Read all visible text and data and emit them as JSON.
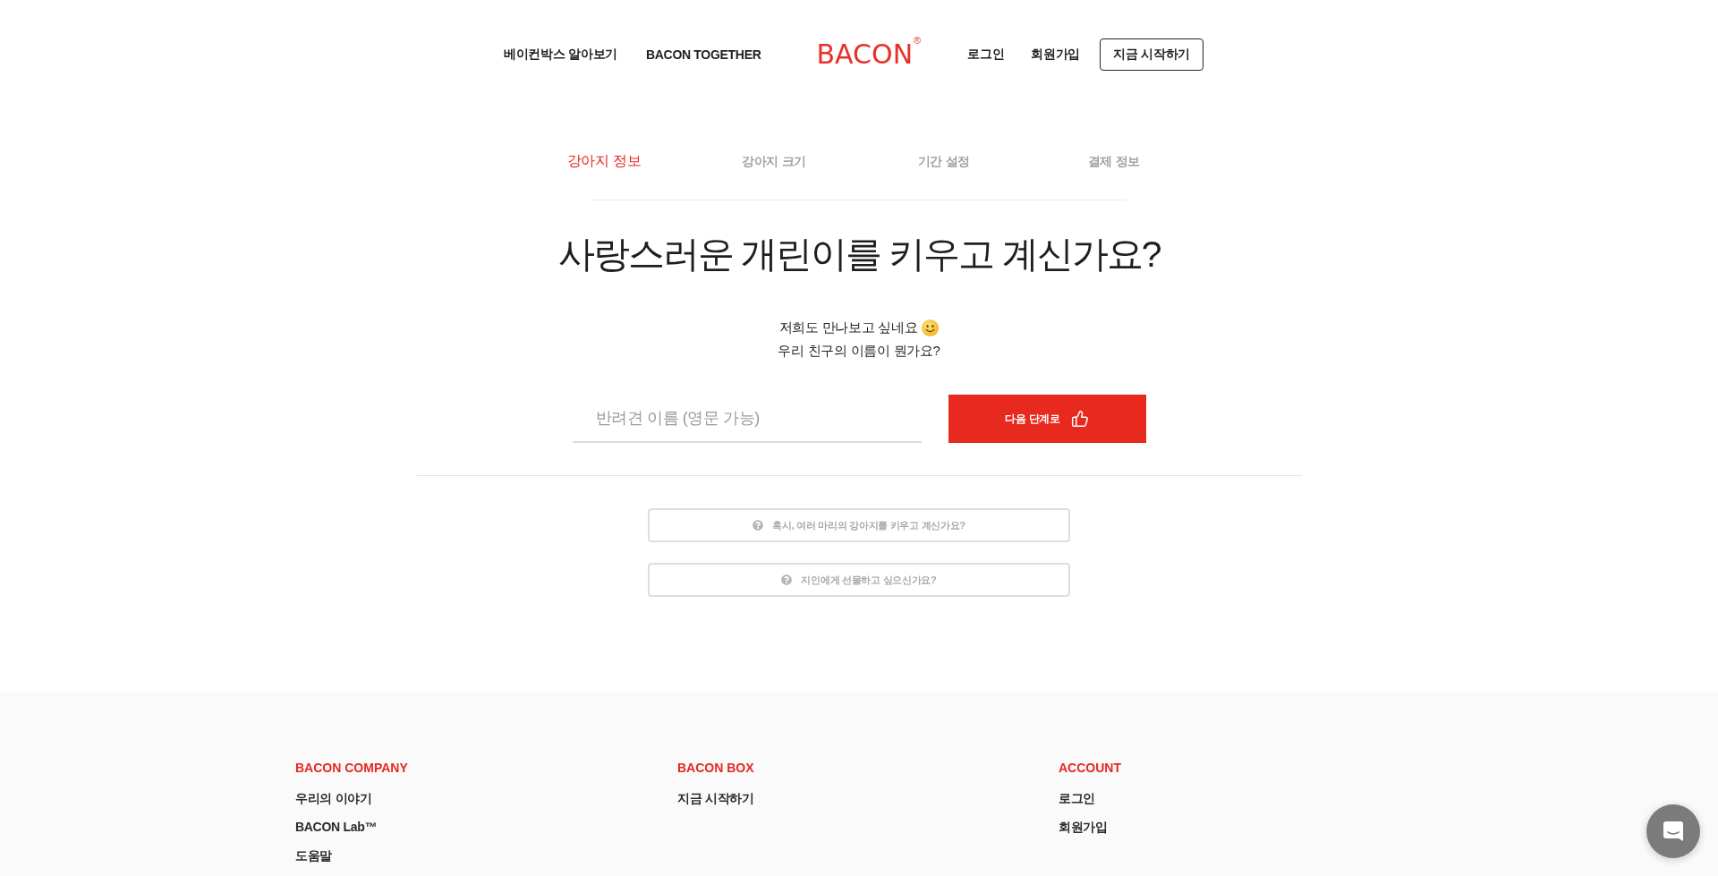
{
  "header": {
    "nav_left": [
      "베이컨박스 알아보기",
      "BACON TOGETHER"
    ],
    "logo": {
      "text": "BACON",
      "mark": "®"
    },
    "nav_right": [
      "로그인",
      "회원가입"
    ],
    "cta": "지금 시작하기"
  },
  "steps": [
    {
      "label": "강아지 정보",
      "selected": true
    },
    {
      "label": "강아지 크기",
      "selected": false
    },
    {
      "label": "기간 설정",
      "selected": false
    },
    {
      "label": "결제 정보",
      "selected": false
    }
  ],
  "question": {
    "title": "사랑스러운 개린이를 키우고 계신가요?",
    "lines": [
      "저희도 만나보고 싶네요",
      "우리 친구의 이름이 뭔가요?"
    ]
  },
  "name_field": {
    "placeholder": "반려견 이름 (영문 가능)"
  },
  "next_button": {
    "label": "다음 단계로"
  },
  "faq": [
    "혹시, 여러 마리의 강아지를 키우고 계신가요?",
    "지인에게 선물하고 싶으신가요?"
  ],
  "footer": {
    "columns": [
      {
        "heading": "BACON COMPANY",
        "links": [
          "우리의 이야기",
          "BACON Lab™",
          "도움말"
        ]
      },
      {
        "heading": "BACON BOX",
        "links": [
          "지금 시작하기"
        ]
      },
      {
        "heading": "ACCOUNT",
        "links": [
          "로그인",
          "회원가입"
        ]
      }
    ]
  }
}
